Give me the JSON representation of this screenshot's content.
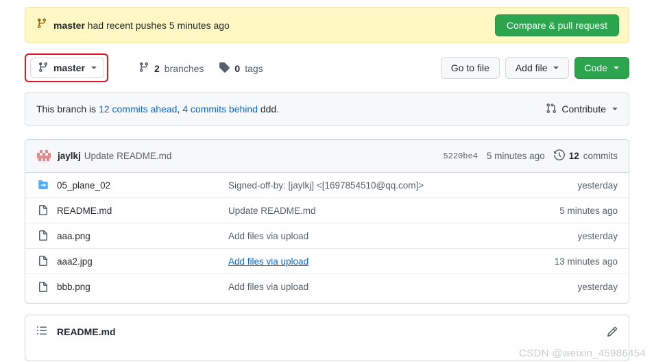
{
  "banner": {
    "branch_icon": "git-branch-icon",
    "branch_name": "master",
    "message": " had recent pushes 5 minutes ago",
    "cta_label": "Compare & pull request",
    "bg_color": "#fff8c5",
    "cta_color": "#2da44e"
  },
  "toolbar": {
    "branch_selector": {
      "icon": "git-branch-icon",
      "label": "master",
      "highlight_color": "#e81123"
    },
    "branches": {
      "count": "2",
      "label": "branches",
      "icon": "git-branch-icon"
    },
    "tags": {
      "count": "0",
      "label": "tags",
      "icon": "tag-icon"
    },
    "go_to_file_label": "Go to file",
    "add_file_label": "Add file",
    "code_label": "Code"
  },
  "branch_status": {
    "prefix": "This branch is ",
    "ahead": "12 commits ahead",
    "separator": ", ",
    "behind": "4 commits behind",
    "suffix": " ddd.",
    "contribute_label": "Contribute",
    "contribute_icon": "git-pull-request-icon",
    "link_color": "#0969da"
  },
  "latest_commit": {
    "avatar": "user-avatar",
    "author": "jaylkj",
    "message": "Update README.md",
    "sha": "5220be4",
    "age": "5 minutes ago",
    "commits_count": "12",
    "commits_label": "commits",
    "history_icon": "history-clock-icon"
  },
  "files": [
    {
      "icon": "submodule-icon",
      "name": "05_plane_02",
      "message": "Signed-off-by: [jaylkj] <[1697854510@qq.com]>",
      "age": "yesterday",
      "linked": false
    },
    {
      "icon": "file-icon",
      "name": "README.md",
      "message": "Update README.md",
      "age": "5 minutes ago",
      "linked": false
    },
    {
      "icon": "file-icon",
      "name": "aaa.png",
      "message": "Add files via upload",
      "age": "yesterday",
      "linked": false
    },
    {
      "icon": "file-icon",
      "name": "aaa2.jpg",
      "message": "Add files via upload",
      "age": "13 minutes ago",
      "linked": true
    },
    {
      "icon": "file-icon",
      "name": "bbb.png",
      "message": "Add files via upload",
      "age": "yesterday",
      "linked": false
    }
  ],
  "readme": {
    "toc_icon": "list-unordered-icon",
    "title": "README.md",
    "edit_icon": "pencil-icon"
  },
  "watermark": "CSDN @weixin_45986454"
}
